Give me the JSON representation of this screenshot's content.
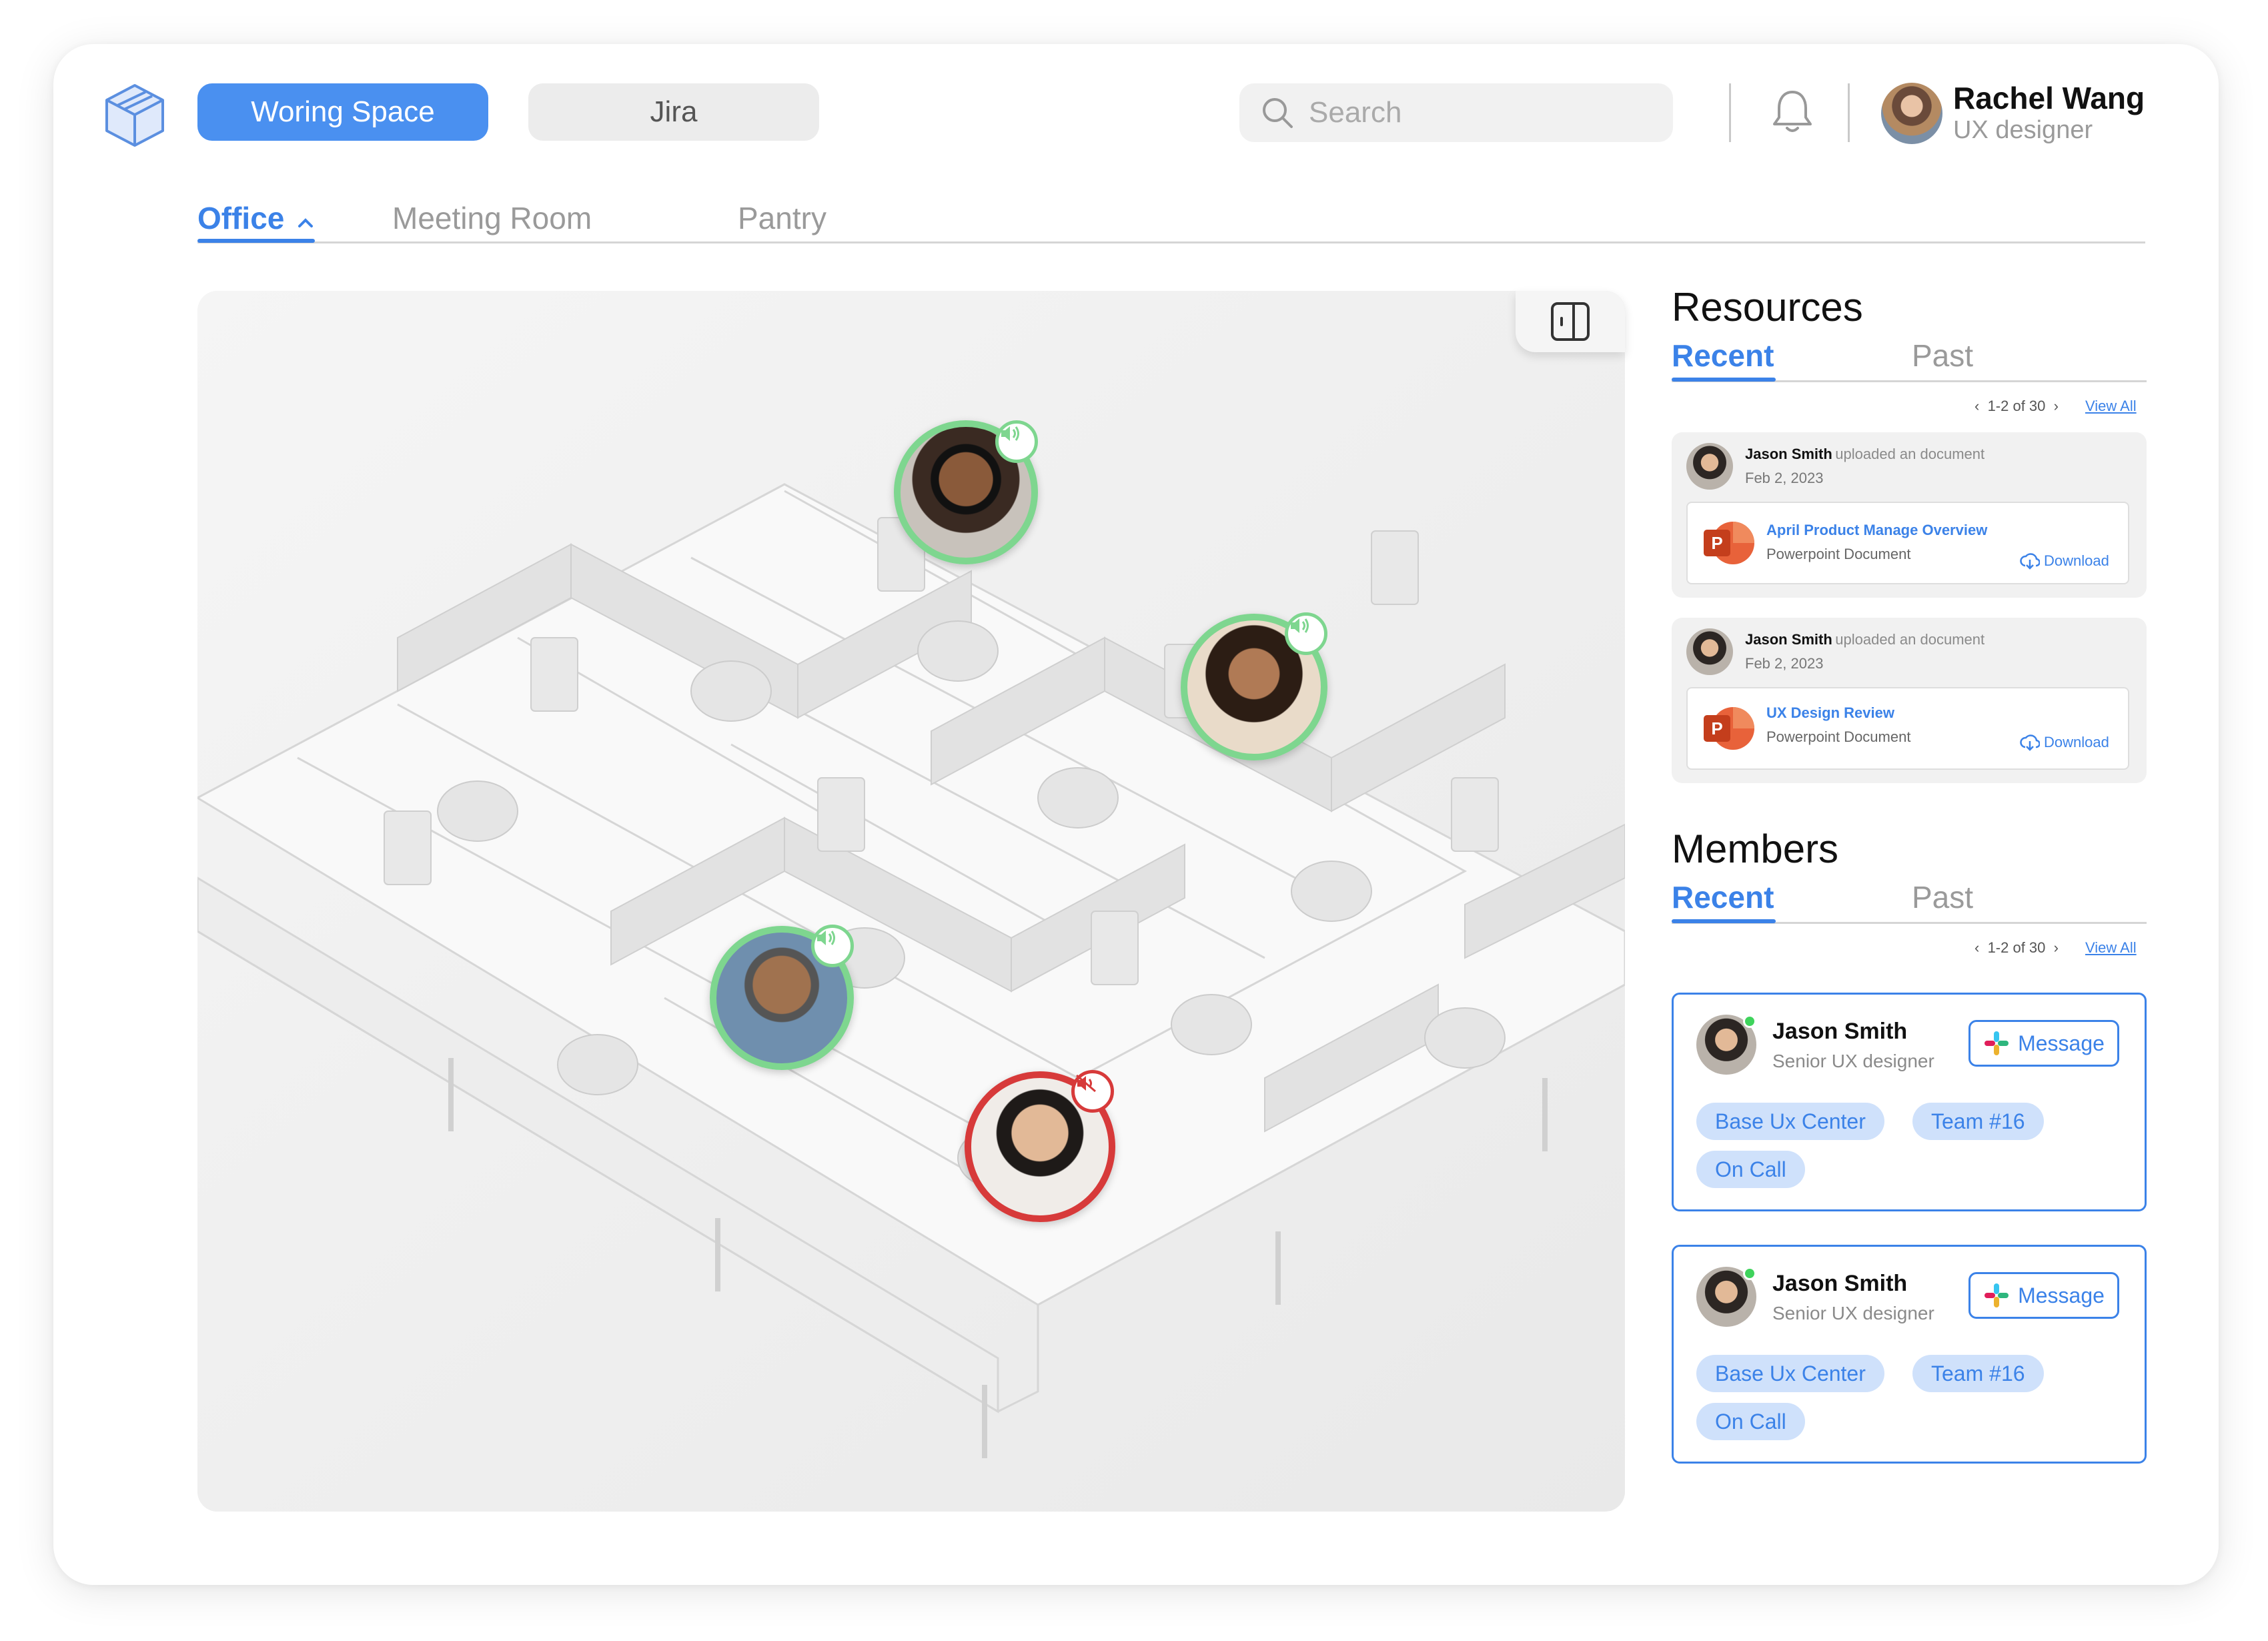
{
  "header": {
    "logo_icon": "isometric-cube-logo",
    "workspace_tab": "Woring Space",
    "jira_tab": "Jira",
    "search_placeholder": "Search",
    "user_name": "Rachel Wang",
    "user_role": "UX designer"
  },
  "subtabs": {
    "office": "Office",
    "meeting_room": "Meeting Room",
    "pantry": "Pantry"
  },
  "map": {
    "toggle_icon": "sidebar-panel-icon",
    "avatars": [
      {
        "id": "masked-man",
        "status": "speaking"
      },
      {
        "id": "curly-woman",
        "status": "speaking"
      },
      {
        "id": "glasses-man",
        "status": "speaking"
      },
      {
        "id": "young-man",
        "status": "muted"
      }
    ]
  },
  "resources": {
    "title": "Resources",
    "tab_recent": "Recent",
    "tab_past": "Past",
    "pager": "1-2 of 30",
    "view_all": "View All",
    "items": [
      {
        "name": "Jason Smith",
        "action": "uploaded an document",
        "date": "Feb 2, 2023",
        "doc_title": "April Product Manage Overview",
        "doc_type": "Powerpoint Document",
        "download": "Download"
      },
      {
        "name": "Jason Smith",
        "action": "uploaded an document",
        "date": "Feb 2, 2023",
        "doc_title": "UX Design Review",
        "doc_type": "Powerpoint Document",
        "download": "Download"
      }
    ]
  },
  "members": {
    "title": "Members",
    "tab_recent": "Recent",
    "tab_past": "Past",
    "pager": "1-2 of 30",
    "view_all": "View All",
    "items": [
      {
        "name": "Jason Smith",
        "role": "Senior UX designer",
        "message": "Message",
        "tags": [
          "Base Ux Center",
          "Team #16",
          "On Call"
        ]
      },
      {
        "name": "Jason Smith",
        "role": "Senior UX designer",
        "message": "Message",
        "tags": [
          "Base Ux Center",
          "Team #16",
          "On Call"
        ]
      }
    ]
  },
  "colors": {
    "accent": "#3b82e8",
    "speaking": "#7ed68f",
    "muted": "#d73a3a"
  }
}
